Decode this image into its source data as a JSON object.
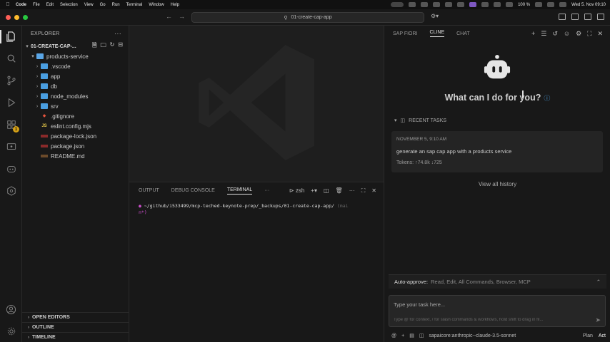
{
  "menubar": {
    "items": [
      "Code",
      "File",
      "Edit",
      "Selection",
      "View",
      "Go",
      "Run",
      "Terminal",
      "Window",
      "Help"
    ],
    "battery": "100 %",
    "clock": "Wed 5. Nov 09:10"
  },
  "titlebar": {
    "search_text": "01-create-cap-app"
  },
  "sidebar": {
    "title": "EXPLORER",
    "root": "01-CREATE-CAP-...",
    "project_folder": "products-service",
    "items": [
      {
        "label": ".vscode",
        "kind": "folder",
        "icon": "folder-icon"
      },
      {
        "label": "app",
        "kind": "folder",
        "icon": "folder-icon"
      },
      {
        "label": "db",
        "kind": "folder",
        "icon": "folder-icon"
      },
      {
        "label": "node_modules",
        "kind": "folder",
        "icon": "folder-icon"
      },
      {
        "label": "srv",
        "kind": "folder",
        "icon": "folder-icon"
      },
      {
        "label": ".gitignore",
        "kind": "file",
        "icon": "git-icon"
      },
      {
        "label": "eslint.config.mjs",
        "kind": "file",
        "icon": "js-icon"
      },
      {
        "label": "package-lock.json",
        "kind": "file",
        "icon": "npm-icon"
      },
      {
        "label": "package.json",
        "kind": "file",
        "icon": "npm-icon"
      },
      {
        "label": "README.md",
        "kind": "file",
        "icon": "markdown-icon"
      }
    ],
    "sections": [
      "OPEN EDITORS",
      "OUTLINE",
      "TIMELINE"
    ]
  },
  "activity": {
    "extensions_badge": "1"
  },
  "panel": {
    "tabs": [
      "OUTPUT",
      "DEBUG CONSOLE",
      "TERMINAL"
    ],
    "active_tab": "TERMINAL",
    "shell": "zsh",
    "terminal_line": "~/github/i533499/mcp-teched-keynote-prep/_backups/01-create-cap-app/",
    "terminal_branch": "(mai",
    "terminal_line2": "n*)"
  },
  "chat": {
    "tabs": [
      "SAP FIORI",
      "CLINE",
      "CHAT"
    ],
    "active_tab": "CLINE",
    "hero": "What can I do for you?",
    "recent_label": "RECENT TASKS",
    "task": {
      "date": "NOVEMBER 5, 9:10 AM",
      "text": "generate an sap cap app with a products service",
      "tokens": "Tokens: ↑74.8k ↓725"
    },
    "view_all": "View all history",
    "auto_approve_label": "Auto-approve:",
    "auto_approve_value": "Read, Edit, All Commands, Browser, MCP",
    "input_placeholder": "Type your task here...",
    "input_hint": "Type @ for context, / for slash commands & workflows, hold shift to drag in fil...",
    "model": "sapaicore:anthropic--claude-3.5-sonnet",
    "plan": "Plan",
    "act": "Act"
  },
  "colors": {
    "accent_blue": "#4a9ee0",
    "traffic_red": "#ff5f57",
    "traffic_yellow": "#febc2e",
    "traffic_green": "#28c840",
    "badge": "#d4a017"
  }
}
